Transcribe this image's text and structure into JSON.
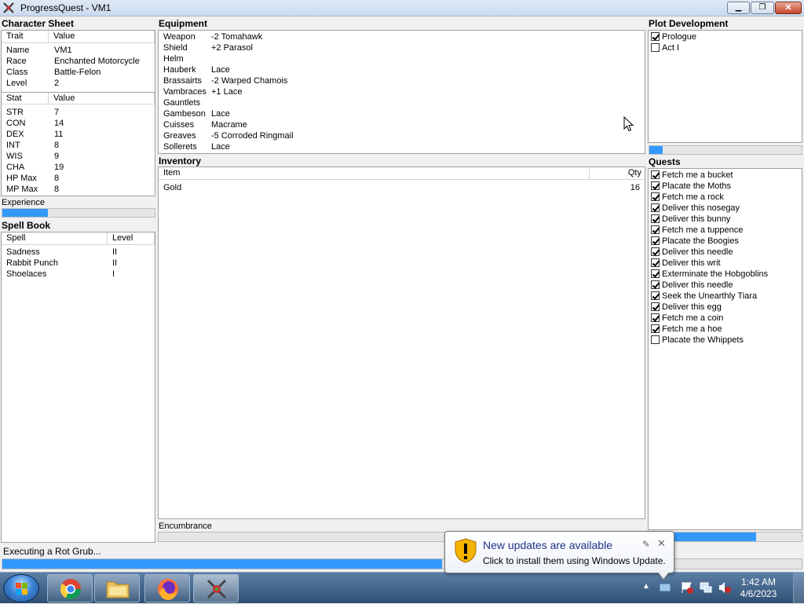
{
  "window": {
    "title": "ProgressQuest - VM1"
  },
  "character_sheet": {
    "title": "Character Sheet",
    "headers": [
      "Trait",
      "Value"
    ],
    "traits": [
      {
        "k": "Name",
        "v": "VM1"
      },
      {
        "k": "Race",
        "v": "Enchanted Motorcycle"
      },
      {
        "k": "Class",
        "v": "Battle-Felon"
      },
      {
        "k": "Level",
        "v": "2"
      }
    ],
    "stat_headers": [
      "Stat",
      "Value"
    ],
    "stats": [
      {
        "k": "STR",
        "v": "7"
      },
      {
        "k": "CON",
        "v": "14"
      },
      {
        "k": "DEX",
        "v": "11"
      },
      {
        "k": "INT",
        "v": "8"
      },
      {
        "k": "WIS",
        "v": "9"
      },
      {
        "k": "CHA",
        "v": "19"
      },
      {
        "k": "HP Max",
        "v": "8"
      },
      {
        "k": "MP Max",
        "v": "8"
      }
    ],
    "experience_label": "Experience",
    "experience_progress": 0.3
  },
  "spell_book": {
    "title": "Spell Book",
    "headers": [
      "Spell",
      "Level"
    ],
    "spells": [
      {
        "k": "Sadness",
        "v": "II"
      },
      {
        "k": "Rabbit Punch",
        "v": "II"
      },
      {
        "k": "Shoelaces",
        "v": "I"
      }
    ]
  },
  "equipment": {
    "title": "Equipment",
    "items": [
      {
        "k": "Weapon",
        "v": "-2 Tomahawk"
      },
      {
        "k": "Shield",
        "v": "+2 Parasol"
      },
      {
        "k": "Helm",
        "v": ""
      },
      {
        "k": "Hauberk",
        "v": "Lace"
      },
      {
        "k": "Brassairts",
        "v": "-2 Warped Chamois"
      },
      {
        "k": "Vambraces",
        "v": "+1 Lace"
      },
      {
        "k": "Gauntlets",
        "v": ""
      },
      {
        "k": "Gambeson",
        "v": "Lace"
      },
      {
        "k": "Cuisses",
        "v": "Macrame"
      },
      {
        "k": "Greaves",
        "v": "-5 Corroded Ringmail"
      },
      {
        "k": "Sollerets",
        "v": "Lace"
      }
    ]
  },
  "inventory": {
    "title": "Inventory",
    "headers": [
      "Item",
      "Qty"
    ],
    "items": [
      {
        "k": "Gold",
        "v": "16"
      }
    ],
    "encumbrance_label": "Encumbrance"
  },
  "plot": {
    "title": "Plot Development",
    "acts": [
      {
        "label": "Prologue",
        "checked": true
      },
      {
        "label": "Act I",
        "checked": false
      }
    ],
    "progress": 0.09
  },
  "quests": {
    "title": "Quests",
    "items": [
      {
        "label": "Fetch me a bucket",
        "checked": true
      },
      {
        "label": "Placate the Moths",
        "checked": true
      },
      {
        "label": "Fetch me a rock",
        "checked": true
      },
      {
        "label": "Deliver this nosegay",
        "checked": true
      },
      {
        "label": "Deliver this bunny",
        "checked": true
      },
      {
        "label": "Fetch me a tuppence",
        "checked": true
      },
      {
        "label": "Placate the Boogies",
        "checked": true
      },
      {
        "label": "Deliver this needle",
        "checked": true
      },
      {
        "label": "Deliver this writ",
        "checked": true
      },
      {
        "label": "Exterminate the Hobgoblins",
        "checked": true
      },
      {
        "label": "Deliver this needle",
        "checked": true
      },
      {
        "label": "Seek the Unearthly Tiara",
        "checked": true
      },
      {
        "label": "Deliver this egg",
        "checked": true
      },
      {
        "label": "Fetch me a coin",
        "checked": true
      },
      {
        "label": "Fetch me a hoe",
        "checked": true
      },
      {
        "label": "Placate the Whippets",
        "checked": false
      }
    ],
    "progress": 0.7
  },
  "status": {
    "text": "Executing a Rot Grub...",
    "progress": 0.55
  },
  "notification": {
    "title": "New updates are available",
    "text": "Click to install them using Windows Update."
  },
  "taskbar": {
    "time": "1:42 AM",
    "date": "4/6/2023"
  },
  "colors": {
    "progress": "#3399ff",
    "taskbar": "#3b5d86"
  }
}
